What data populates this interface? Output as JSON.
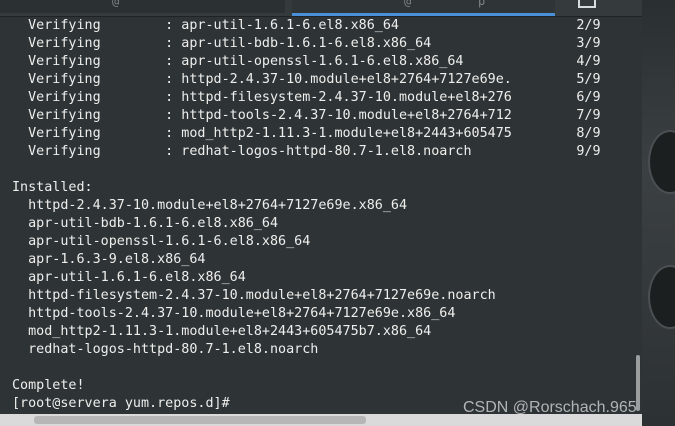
{
  "terminal": {
    "verify_lines": [
      "  Verifying        : apr-util-1.6.1-6.el8.x86_64                      2/9",
      "  Verifying        : apr-util-bdb-1.6.1-6.el8.x86_64                  3/9",
      "  Verifying        : apr-util-openssl-1.6.1-6.el8.x86_64              4/9",
      "  Verifying        : httpd-2.4.37-10.module+el8+2764+7127e69e.        5/9",
      "  Verifying        : httpd-filesystem-2.4.37-10.module+el8+276        6/9",
      "  Verifying        : httpd-tools-2.4.37-10.module+el8+2764+712        7/9",
      "  Verifying        : mod_http2-1.11.3-1.module+el8+2443+605475        8/9",
      "  Verifying        : redhat-logos-httpd-80.7-1.el8.noarch             9/9"
    ],
    "installed_header": "Installed:",
    "installed_packages": [
      "  httpd-2.4.37-10.module+el8+2764+7127e69e.x86_64",
      "  apr-util-bdb-1.6.1-6.el8.x86_64",
      "  apr-util-openssl-1.6.1-6.el8.x86_64",
      "  apr-1.6.3-9.el8.x86_64",
      "  apr-util-1.6.1-6.el8.x86_64",
      "  httpd-filesystem-2.4.37-10.module+el8+2764+7127e69e.noarch",
      "  httpd-tools-2.4.37-10.module+el8+2764+7127e69e.x86_64",
      "  mod_http2-1.11.3-1.module+el8+2443+605475b7.x86_64",
      "  redhat-logos-httpd-80.7-1.el8.noarch"
    ],
    "complete": "Complete!",
    "prompt": "[root@servera yum.repos.d]#"
  },
  "watermark": "CSDN @Rorschach.965"
}
